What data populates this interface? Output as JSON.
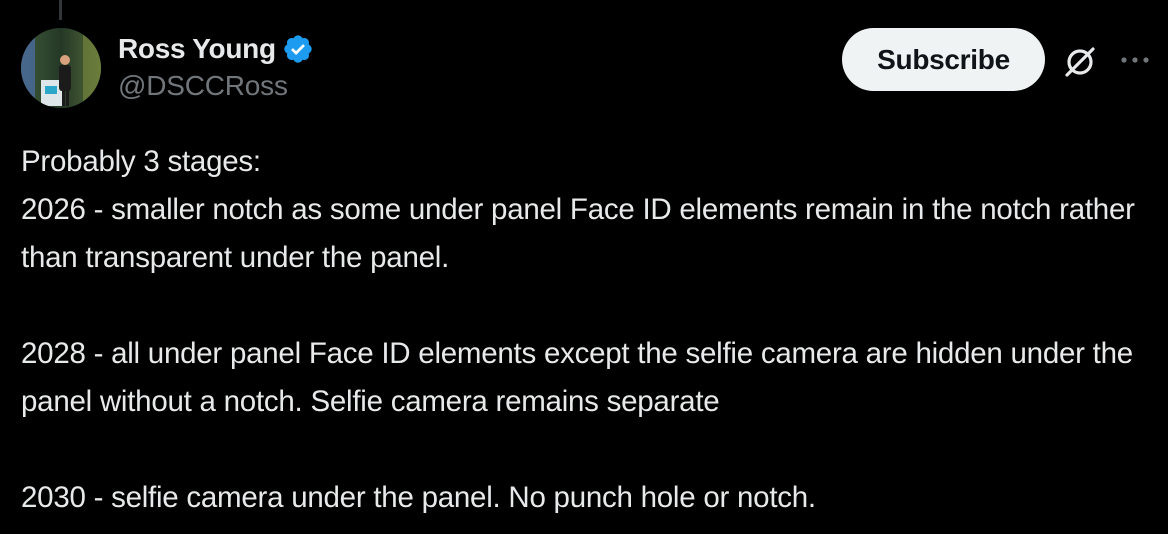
{
  "author": {
    "display_name": "Ross Young",
    "handle": "@DSCCRoss",
    "verified": true,
    "verified_color": "#1d9bf0"
  },
  "actions": {
    "subscribe_label": "Subscribe",
    "grok_icon": "grok-icon",
    "more_icon": "more-icon"
  },
  "tweet": {
    "lines": [
      "Probably 3 stages:",
      "2026 - smaller notch as some under panel Face ID elements remain in the notch rather than transparent under the panel.",
      "2028 - all under panel Face ID elements except the selfie camera are hidden under the panel without a notch. Selfie camera remains separate",
      "2030 - selfie camera under the panel. No punch hole or notch."
    ]
  },
  "colors": {
    "background": "#000000",
    "text": "#e7e9ea",
    "secondary_text": "#71767b",
    "button_bg": "#eff3f4"
  }
}
